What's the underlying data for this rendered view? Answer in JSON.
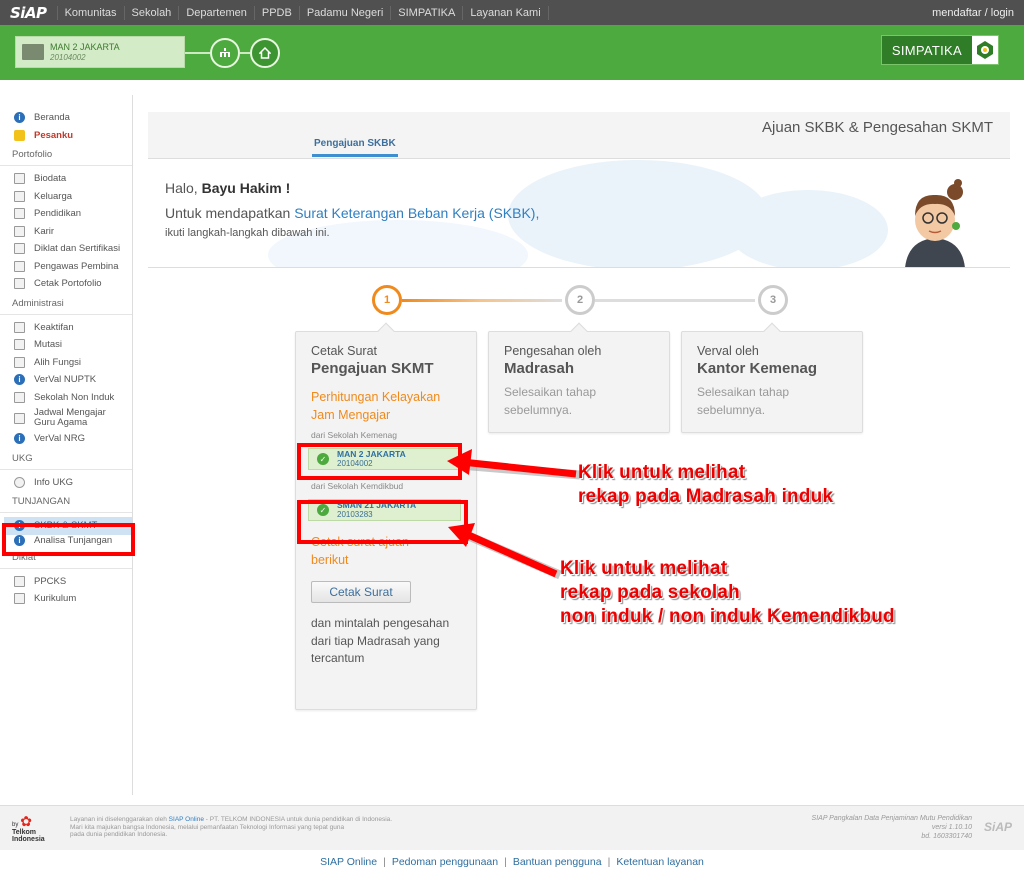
{
  "topbar": {
    "logo": "SiAP",
    "nav": [
      "Komunitas",
      "Sekolah",
      "Departemen",
      "PPDB",
      "Padamu Negeri",
      "SIMPATIKA",
      "Layanan Kami"
    ],
    "login": "mendaftar / login"
  },
  "header": {
    "school_name": "MAN 2 JAKARTA",
    "school_code": "20104002",
    "brand": "SIMPATIKA"
  },
  "sidebar": {
    "items_top": [
      {
        "label": "Beranda",
        "icon": "info-icon"
      },
      {
        "label": "Pesanku",
        "icon": "message-icon"
      }
    ],
    "portofolio_title": "Portofolio",
    "portofolio": [
      "Biodata",
      "Keluarga",
      "Pendidikan",
      "Karir",
      "Diklat dan Sertifikasi",
      "Pengawas Pembina",
      "Cetak Portofolio"
    ],
    "administrasi_title": "Administrasi",
    "administrasi": [
      "Keaktifan",
      "Mutasi",
      "Alih Fungsi",
      "VerVal NUPTK",
      "Sekolah Non Induk",
      "Jadwal Mengajar Guru Agama",
      "VerVal NRG"
    ],
    "ukg_title": "UKG",
    "ukg": [
      "Info UKG"
    ],
    "tunjangan_title": "TUNJANGAN",
    "tunjangan": [
      "SKBK & SKMT",
      "Analisa Tunjangan"
    ],
    "diklat_title": "Diklat",
    "diklat": [
      "PPCKS",
      "Kurikulum"
    ]
  },
  "main": {
    "page_title": "Ajuan SKBK & Pengesahan SKMT",
    "tab": "Pengajuan SKBK",
    "greeting_hello": "Halo, ",
    "greeting_name": "Bayu Hakim !",
    "line2_pre": "Untuk mendapatkan ",
    "line2_link": "Surat Keterangan Beban Kerja (SKBK),",
    "line3": "ikuti langkah-langkah dibawah ini."
  },
  "steps": [
    "1",
    "2",
    "3"
  ],
  "card1": {
    "sub": "Cetak Surat",
    "title": "Pengajuan SKMT",
    "orange": "Perhitungan Kelayakan Jam Mengajar",
    "from1": "dari Sekolah Kemenag",
    "chip1_name": "MAN 2 JAKARTA",
    "chip1_code": "20104002",
    "from2": "dari Sekolah Kemdikbud",
    "chip2_name": "SMAN 21 JAKARTA",
    "chip2_code": "20103283",
    "orange2": "Cetak surat ajuan berikut",
    "button": "Cetak Surat",
    "text": "dan mintalah pengesahan dari tiap Madrasah yang tercantum"
  },
  "card2": {
    "sub": "Pengesahan oleh",
    "title": "Madrasah",
    "desc": "Selesaikan tahap sebelumnya."
  },
  "card3": {
    "sub": "Verval oleh",
    "title": "Kantor Kemenag",
    "desc": "Selesaikan tahap sebelumnya."
  },
  "annotations": {
    "a1_line1": "Klik untuk melihat",
    "a1_line2": "rekap pada Madrasah induk",
    "a2_line1": "Klik untuk melihat",
    "a2_line2": "rekap pada sekolah",
    "a2_line3": "non induk / non induk Kemendikbud"
  },
  "footer": {
    "telkom_by": "by",
    "telkom_name": "Telkom Indonesia",
    "text_pre": "Layanan ini diselenggarakan oleh ",
    "text_link": "SIAP Online",
    "text_post": " - PT. TELKOM INDONESIA untuk dunia pendidikan di Indonesia.",
    "text2": "Mari kita majukan bangsa Indonesia, melalui pemanfaatan Teknologi Informasi yang tepat guna",
    "text3": "pada dunia pendidikan Indonesia.",
    "right1": "SIAP Pangkalan Data Penjaminan Mutu Pendidikan",
    "right2": "versi 1.10.10",
    "right3": "bd. 1603301740",
    "siap": "SiAP",
    "links": [
      "SIAP Online",
      "Pedoman penggunaan",
      "Bantuan pengguna",
      "Ketentuan layanan"
    ]
  },
  "colors": {
    "green": "#4daa3e",
    "orange": "#f08a1c",
    "annotation_red": "#ff0000"
  }
}
